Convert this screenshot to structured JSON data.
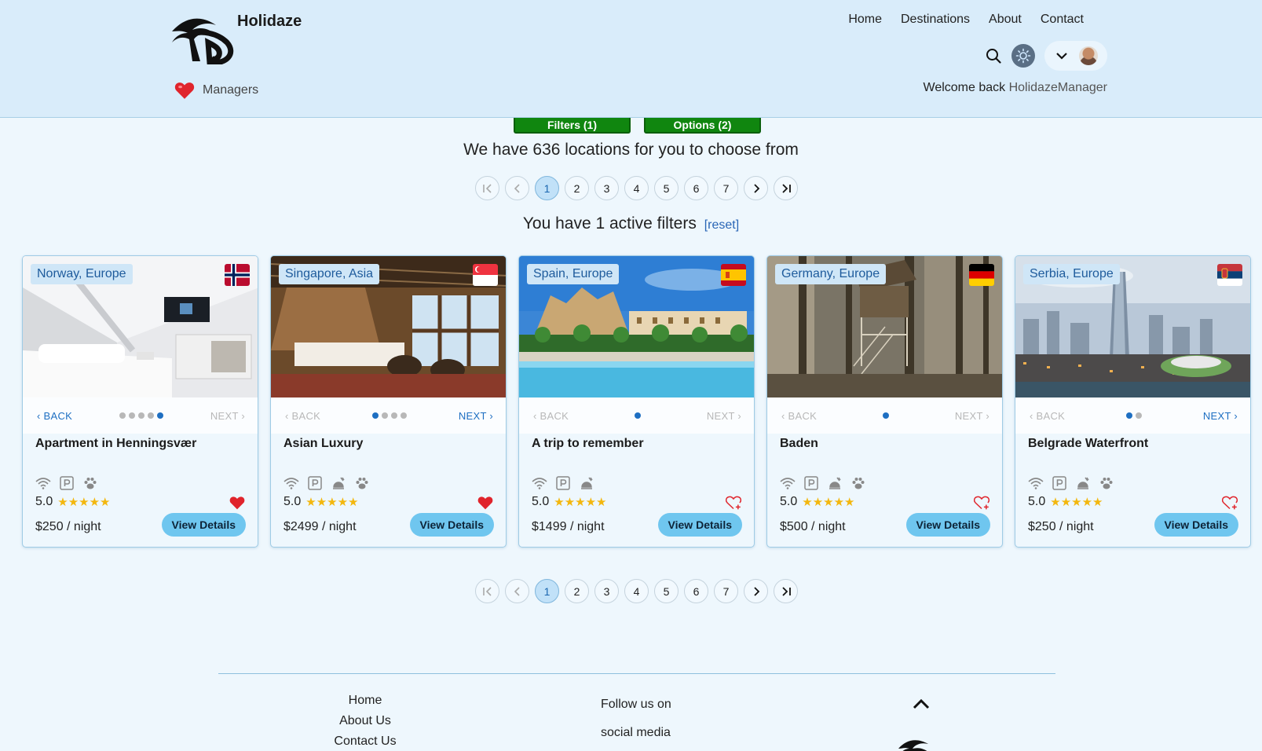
{
  "header": {
    "brand": "Holidaze",
    "managers_label": "Managers",
    "nav": [
      "Home",
      "Destinations",
      "About",
      "Contact"
    ],
    "welcome_prefix": "Welcome back",
    "username": "HolidazeManager"
  },
  "controls": {
    "filters_label": "Filters (1)",
    "options_label": "Options (2)",
    "count_text": "We have 636 locations for you to choose from",
    "active_filters_text": "You have 1 active filters",
    "reset_label": "[reset]"
  },
  "pagination": {
    "pages": [
      "1",
      "2",
      "3",
      "4",
      "5",
      "6",
      "7"
    ],
    "current": "1"
  },
  "cards": [
    {
      "location": "Norway, Europe",
      "title": "Apartment in Henningsvær",
      "rating": "5.0",
      "price": "$250 / night",
      "favorited": true,
      "dots": 5,
      "active_dot": 5,
      "back_enabled": true,
      "next_enabled": false,
      "flag": "norway",
      "amenities": [
        "wifi",
        "parking",
        "pets"
      ]
    },
    {
      "location": "Singapore, Asia",
      "title": "Asian Luxury",
      "rating": "5.0",
      "price": "$2499 / night",
      "favorited": true,
      "dots": 4,
      "active_dot": 1,
      "back_enabled": false,
      "next_enabled": true,
      "flag": "singapore",
      "amenities": [
        "wifi",
        "parking",
        "breakfast",
        "pets"
      ]
    },
    {
      "location": "Spain, Europe",
      "title": "A trip to remember",
      "rating": "5.0",
      "price": "$1499 / night",
      "favorited": false,
      "dots": 1,
      "active_dot": 1,
      "back_enabled": false,
      "next_enabled": false,
      "flag": "spain",
      "amenities": [
        "wifi",
        "parking",
        "breakfast"
      ]
    },
    {
      "location": "Germany, Europe",
      "title": "Baden",
      "rating": "5.0",
      "price": "$500 / night",
      "favorited": false,
      "dots": 1,
      "active_dot": 1,
      "back_enabled": false,
      "next_enabled": false,
      "flag": "germany",
      "amenities": [
        "wifi",
        "parking",
        "breakfast",
        "pets"
      ]
    },
    {
      "location": "Serbia, Europe",
      "title": "Belgrade Waterfront",
      "rating": "5.0",
      "price": "$250 / night",
      "favorited": false,
      "dots": 2,
      "active_dot": 1,
      "back_enabled": false,
      "next_enabled": true,
      "flag": "serbia",
      "amenities": [
        "wifi",
        "parking",
        "breakfast",
        "pets"
      ]
    }
  ],
  "card_labels": {
    "back": "BACK",
    "next": "NEXT",
    "view_details": "View Details"
  },
  "footer": {
    "links": [
      "Home",
      "About Us",
      "Contact Us"
    ],
    "follow_line1": "Follow us on",
    "follow_line2": "social media"
  },
  "colors": {
    "header_bg": "#d9ecfa",
    "page_bg": "#eef7fd",
    "accent_green": "#10860f",
    "button_blue": "#6fc6ef",
    "link_blue": "#1e6fc2",
    "star": "#f3b70e",
    "heart_red": "#e0242c"
  }
}
